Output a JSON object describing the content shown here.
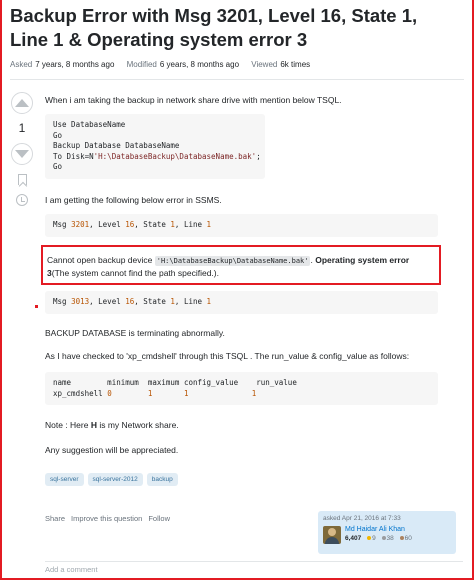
{
  "question": {
    "title": "Backup Error with Msg 3201, Level 16, State 1, Line 1 & Operating system error 3",
    "meta": {
      "asked_label": "Asked",
      "asked_value": "7 years, 8 months ago",
      "modified_label": "Modified",
      "modified_value": "6 years, 8 months ago",
      "viewed_label": "Viewed",
      "viewed_value": "6k times"
    },
    "score": "1",
    "intro": "When i am taking the backup in network share drive with mention below TSQL.",
    "code1": {
      "line1": "Use DatabaseName",
      "line2": "Go",
      "line3": "Backup Database DatabaseName",
      "line4a": "To Disk=N",
      "line4b": "'H:\\DatabaseBackup\\DatabaseName.bak'",
      "line4c": ";",
      "line5": "Go"
    },
    "error_intro": "I am getting the following below error in SSMS.",
    "err1": {
      "a": "Msg ",
      "n1": "3201",
      "b": ", Level ",
      "n2": "16",
      "c": ", State ",
      "n3": "1",
      "d": ", Line ",
      "n4": "1"
    },
    "highlight": {
      "pre": "Cannot open backup device ",
      "code": "'H:\\DatabaseBackup\\DatabaseName.bak'",
      "mid": ". ",
      "bold1": "Operating system error",
      "bold2": "3",
      "post": "(The system cannot find the path specified.)."
    },
    "err2": {
      "a": "Msg ",
      "n1": "3013",
      "b": ", Level ",
      "n2": "16",
      "c": ", State ",
      "n3": "1",
      "d": ", Line ",
      "n4": "1"
    },
    "terminating": "BACKUP DATABASE is terminating abnormally.",
    "checked": "As I have checked to 'xp_cmdshell' through this TSQL . The run_value & config_value as follows:",
    "table": {
      "header": "name        minimum  maximum config_value    run_value",
      "row_name": "xp_cmdshell ",
      "row_min": "0",
      "row_max": "1",
      "row_cfg": "1",
      "row_run": "1"
    },
    "note_pre": "Note : Here ",
    "note_bold": "H",
    "note_post": " is my Network share.",
    "suggestion": "Any suggestion will be appreciated.",
    "tags": [
      "sql-server",
      "sql-server-2012",
      "backup"
    ],
    "actions": [
      "Share",
      "Improve this question",
      "Follow"
    ],
    "user": {
      "asked": "asked Apr 21, 2016 at 7:33",
      "name": "Md Haidar Ali Khan",
      "rep": "6,407",
      "gold": "9",
      "silver": "38",
      "bronze": "60"
    },
    "add_comment": "Add a comment"
  },
  "colors": {
    "highlight_border": "#e31b23",
    "tag_bg": "#e1ecf4",
    "tag_text": "#39739d",
    "link": "#0074cc"
  }
}
